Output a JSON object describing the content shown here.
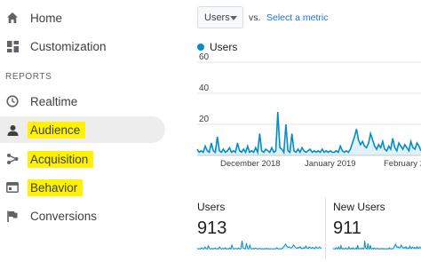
{
  "sidebar": {
    "items_top": [
      {
        "label": "Home",
        "icon": "home-icon"
      },
      {
        "label": "Customization",
        "icon": "dashboard-grid-icon"
      }
    ],
    "section_label": "REPORTS",
    "items_reports": [
      {
        "label": "Realtime",
        "icon": "clock-icon"
      },
      {
        "label": "Audience",
        "icon": "person-icon",
        "active": true,
        "highlighted": true
      },
      {
        "label": "Acquisition",
        "icon": "share-branch-icon",
        "highlighted": true
      },
      {
        "label": "Behavior",
        "icon": "browser-window-icon",
        "highlighted": true
      },
      {
        "label": "Conversions",
        "icon": "flag-icon"
      }
    ]
  },
  "toolbar": {
    "metric_select": "Users",
    "vs_label": "vs.",
    "select_metric_link": "Select a metric"
  },
  "colors": {
    "series": "#058dc7",
    "highlight": "#fff200",
    "link": "#1a73e8"
  },
  "chart_data": {
    "type": "line",
    "series": [
      {
        "name": "Users",
        "values": [
          4,
          2,
          3,
          2,
          6,
          3,
          2,
          8,
          3,
          2,
          12,
          3,
          2,
          4,
          2,
          3,
          5,
          2,
          3,
          2,
          8,
          3,
          2,
          4,
          2,
          6,
          2,
          3,
          2,
          5,
          2,
          14,
          3,
          2,
          4,
          3,
          2,
          5,
          2,
          3,
          28,
          5,
          4,
          2,
          20,
          3,
          2,
          14,
          3,
          2,
          4,
          2,
          5,
          3,
          2,
          3,
          4,
          2,
          3,
          2,
          3,
          2,
          4,
          2,
          3,
          2,
          3,
          2,
          2,
          3,
          2,
          6,
          3,
          2,
          3,
          2,
          4,
          8,
          12,
          17,
          10,
          7,
          9,
          6,
          5,
          8,
          14,
          10,
          6,
          4,
          7,
          5,
          9,
          4,
          3,
          6,
          4,
          11,
          5,
          3,
          8,
          6,
          4,
          7,
          5,
          3,
          9,
          5,
          4,
          8,
          6,
          3
        ]
      }
    ],
    "x_tick_labels": [
      "December 2018",
      "January 2019",
      "February 2"
    ],
    "y_ticks": [
      20,
      40,
      60
    ],
    "ylim": [
      0,
      60
    ],
    "grid": true
  },
  "scorecards": [
    {
      "title": "Users",
      "value": "913"
    },
    {
      "title": "New Users",
      "value": "911"
    }
  ]
}
